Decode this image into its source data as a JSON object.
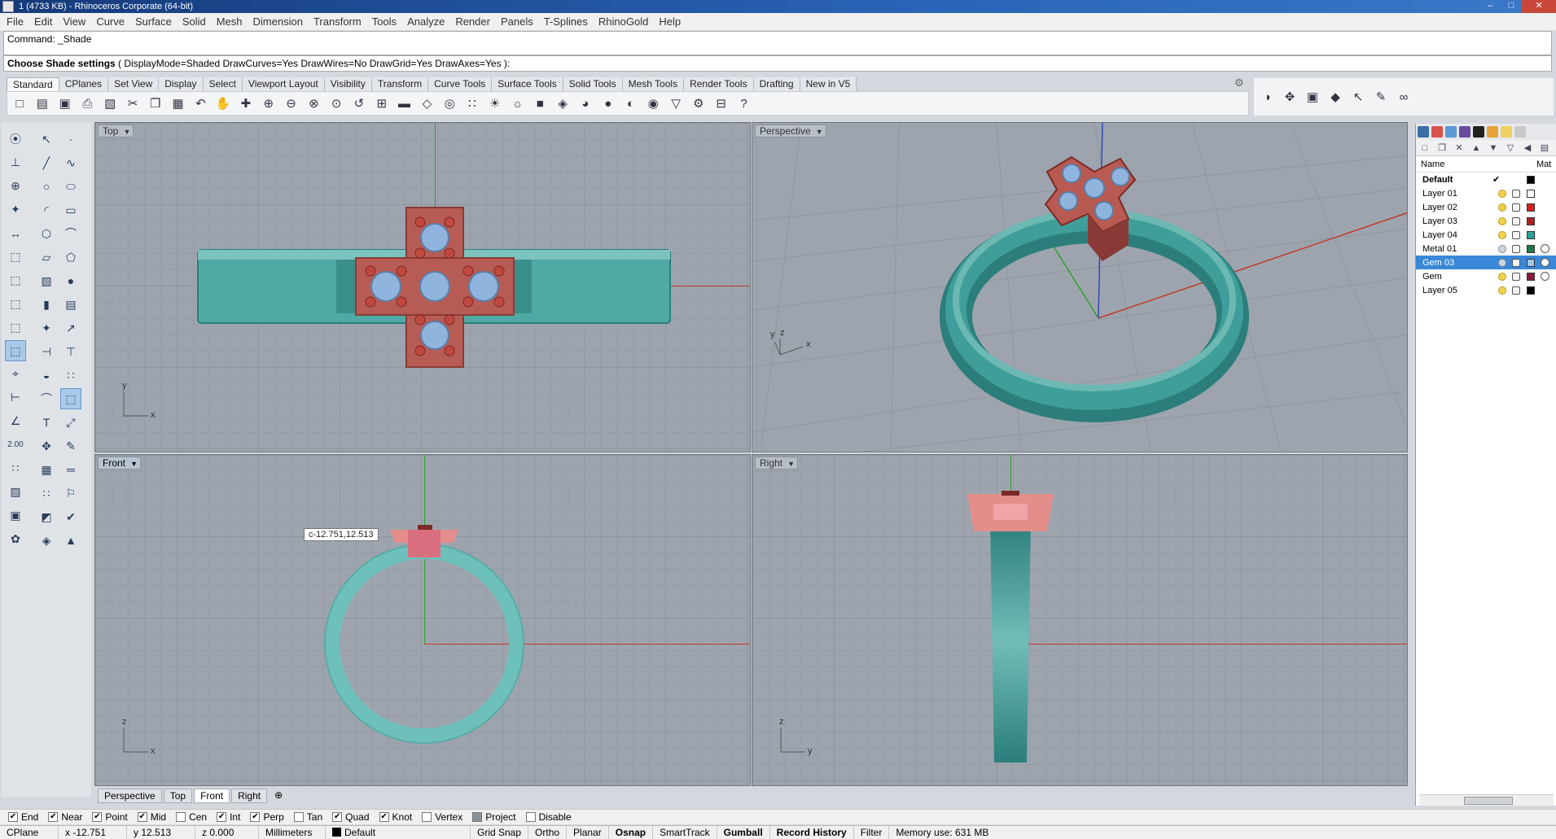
{
  "window": {
    "title": "1 (4733 KB) - Rhinoceros Corporate (64-bit)",
    "controls": [
      "–",
      "□",
      "✕"
    ]
  },
  "menu": [
    "File",
    "Edit",
    "View",
    "Curve",
    "Surface",
    "Solid",
    "Mesh",
    "Dimension",
    "Transform",
    "Tools",
    "Analyze",
    "Render",
    "Panels",
    "T-Splines",
    "RhinoGold",
    "Help"
  ],
  "command": {
    "history": "Command: _Shade",
    "prompt_bold": "Choose Shade settings",
    "prompt_rest": " ( DisplayMode=Shaded  DrawCurves=Yes  DrawWires=No  DrawGrid=Yes  DrawAxes=Yes ):"
  },
  "toolbar_tabs": [
    "Standard",
    "CPlanes",
    "Set View",
    "Display",
    "Select",
    "Viewport Layout",
    "Visibility",
    "Transform",
    "Curve Tools",
    "Surface Tools",
    "Solid Tools",
    "Mesh Tools",
    "Render Tools",
    "Drafting",
    "New in V5"
  ],
  "toolbar_icons": [
    {
      "name": "new-icon",
      "glyph": "□"
    },
    {
      "name": "open-icon",
      "glyph": "▤"
    },
    {
      "name": "save-icon",
      "glyph": "▣"
    },
    {
      "name": "print-icon",
      "glyph": "⎙"
    },
    {
      "name": "import-icon",
      "glyph": "▧"
    },
    {
      "name": "cut-icon",
      "glyph": "✂"
    },
    {
      "name": "copy-icon",
      "glyph": "❐"
    },
    {
      "name": "paste-icon",
      "glyph": "▦"
    },
    {
      "name": "undo-icon",
      "glyph": "↶"
    },
    {
      "name": "pan-icon",
      "glyph": "✋"
    },
    {
      "name": "rotate-view-icon",
      "glyph": "✚"
    },
    {
      "name": "zoom-dynamic-icon",
      "glyph": "⊕"
    },
    {
      "name": "zoom-window-icon",
      "glyph": "⊖"
    },
    {
      "name": "zoom-extents-icon",
      "glyph": "⊗"
    },
    {
      "name": "zoom-selected-icon",
      "glyph": "⊙"
    },
    {
      "name": "undo-view-icon",
      "glyph": "↺"
    },
    {
      "name": "four-viewports-icon",
      "glyph": "⊞"
    },
    {
      "name": "car-icon",
      "glyph": "▬"
    },
    {
      "name": "box-edit-icon",
      "glyph": "◇"
    },
    {
      "name": "osnap-icon",
      "glyph": "◎"
    },
    {
      "name": "select-points-icon",
      "glyph": "∷"
    },
    {
      "name": "light-icon",
      "glyph": "☀"
    },
    {
      "name": "light-off-icon",
      "glyph": "☼"
    },
    {
      "name": "lock-icon",
      "glyph": "■"
    },
    {
      "name": "layer-icon",
      "glyph": "◈"
    },
    {
      "name": "color-wheel-icon",
      "glyph": "◕"
    },
    {
      "name": "sphere-shaded-icon",
      "glyph": "●"
    },
    {
      "name": "sphere-rendered-icon",
      "glyph": "◐"
    },
    {
      "name": "sphere-blue-icon",
      "glyph": "◉"
    },
    {
      "name": "filter-icon",
      "glyph": "▽"
    },
    {
      "name": "options-gear-icon",
      "glyph": "⚙"
    },
    {
      "name": "grid-tool-icon",
      "glyph": "⊟"
    },
    {
      "name": "help-icon",
      "glyph": "?"
    }
  ],
  "toolbar_right_icons": [
    {
      "name": "shaded-ball-icon",
      "glyph": "◑"
    },
    {
      "name": "move-icon",
      "glyph": "✥"
    },
    {
      "name": "save-small-icon",
      "glyph": "▣"
    },
    {
      "name": "cube-blue-icon",
      "glyph": "◆"
    },
    {
      "name": "pointer-icon",
      "glyph": "↖"
    },
    {
      "name": "edit-tool-icon",
      "glyph": "✎"
    },
    {
      "name": "link-icon",
      "glyph": "∞"
    }
  ],
  "toolbox": {
    "col1": [
      {
        "name": "cancel-icon",
        "glyph": "⦿"
      },
      {
        "name": "cplane-icon",
        "glyph": "⊥"
      },
      {
        "name": "globe-icon",
        "glyph": "⊕"
      },
      {
        "name": "gumball-icon",
        "glyph": "✦"
      },
      {
        "name": "dimension-icon",
        "glyph": "↔"
      },
      {
        "name": "box-tool-icon",
        "glyph": "⬚"
      },
      {
        "name": "box-tool-2-icon",
        "glyph": "⬚"
      },
      {
        "name": "box-tool-3-icon",
        "glyph": "⬚"
      },
      {
        "name": "box-tool-4-icon",
        "glyph": "⬚"
      },
      {
        "name": "box-tool-selected-icon",
        "glyph": "⬚"
      },
      {
        "name": "snap-tool-icon",
        "glyph": "⌖"
      },
      {
        "name": "ortho-tool-icon",
        "glyph": "⊢"
      },
      {
        "name": "radius-tool-icon",
        "glyph": "∠"
      },
      {
        "name": "value-box-icon",
        "glyph": "∷"
      },
      {
        "name": "hatch-icon",
        "glyph": "▨"
      },
      {
        "name": "frame-icon",
        "glyph": "▣"
      },
      {
        "name": "color-flower-icon",
        "glyph": "✿"
      }
    ],
    "value_label": "2.00",
    "col2": [
      {
        "name": "select-icon",
        "glyph": "↖"
      },
      {
        "name": "point-icon",
        "glyph": "·"
      },
      {
        "name": "polyline-icon",
        "glyph": "╱"
      },
      {
        "name": "curve-icon",
        "glyph": "∿"
      },
      {
        "name": "circle-icon",
        "glyph": "○"
      },
      {
        "name": "ellipse-icon",
        "glyph": "⬭"
      },
      {
        "name": "arc-icon",
        "glyph": "◜"
      },
      {
        "name": "rectangle-icon",
        "glyph": "▭"
      },
      {
        "name": "polygon-icon",
        "glyph": "⬡"
      },
      {
        "name": "fillet-icon",
        "glyph": "⌒"
      },
      {
        "name": "surface-icon",
        "glyph": "▱"
      },
      {
        "name": "loft-icon",
        "glyph": "⬠"
      },
      {
        "name": "solid-box-icon",
        "glyph": "▧"
      },
      {
        "name": "sphere-tool-icon",
        "glyph": "●"
      },
      {
        "name": "cylinder-icon",
        "glyph": "▮"
      },
      {
        "name": "extrude-icon",
        "glyph": "▤"
      },
      {
        "name": "mesh-icon",
        "glyph": "✦"
      },
      {
        "name": "arrow-icon",
        "glyph": "↗"
      },
      {
        "name": "dim-tool-icon",
        "glyph": "⊣"
      },
      {
        "name": "dim-tool-2-icon",
        "glyph": "⊤"
      },
      {
        "name": "boolean-icon",
        "glyph": "◒"
      },
      {
        "name": "split-icon",
        "glyph": "∷"
      },
      {
        "name": "trim-icon",
        "glyph": "⌒"
      },
      {
        "name": "offset-icon",
        "glyph": "⬚"
      },
      {
        "name": "text-icon",
        "glyph": "T"
      },
      {
        "name": "scale-icon",
        "glyph": "⤢"
      },
      {
        "name": "transform-icon",
        "glyph": "✥"
      },
      {
        "name": "edit-pts-icon",
        "glyph": "✎"
      },
      {
        "name": "solid-edit-icon",
        "glyph": "▦"
      },
      {
        "name": "ruler-icon",
        "glyph": "═"
      },
      {
        "name": "array-icon",
        "glyph": "∷"
      },
      {
        "name": "render-tool-icon",
        "glyph": "⚐"
      },
      {
        "name": "drafting-icon",
        "glyph": "◩"
      },
      {
        "name": "check-icon",
        "glyph": "✔"
      },
      {
        "name": "mesh-tool-icon",
        "glyph": "◈"
      },
      {
        "name": "cone-icon",
        "glyph": "▲"
      }
    ]
  },
  "viewports": {
    "top": {
      "label": "Top",
      "axis_x": "x",
      "axis_y": "y"
    },
    "perspective": {
      "label": "Perspective",
      "axis_x": "x",
      "axis_y": "y",
      "axis_z": "z"
    },
    "front": {
      "label": "Front",
      "axis_x": "x",
      "axis_z": "z"
    },
    "right": {
      "label": "Right",
      "axis_y": "y",
      "axis_z": "z"
    }
  },
  "coord_tooltip": "c-12.751,12.513",
  "viewport_tabs": [
    "Perspective",
    "Top",
    "Front",
    "Right"
  ],
  "viewport_tab_add": "⊕",
  "colors": {
    "ring": "#3f9e9a",
    "ring_dark": "#2b7e7b",
    "ring_light": "#78c2be",
    "cross": "#b85a52",
    "cross_dark": "#8a3a36",
    "gem": "#8fb4de",
    "grid_bg": "#9da4ad"
  },
  "layers": {
    "header_name": "Name",
    "header_mat": "Mat",
    "rows": [
      {
        "name": "Default",
        "current": "✔",
        "color": "#000000",
        "bold": true
      },
      {
        "name": "Layer 01",
        "color": "#ffffff"
      },
      {
        "name": "Layer 02",
        "color": "#d81e1e"
      },
      {
        "name": "Layer 03",
        "color": "#b22222"
      },
      {
        "name": "Layer 04",
        "color": "#2aa39a"
      },
      {
        "name": "Metal 01",
        "color": "#1f7a4a",
        "mat": true
      },
      {
        "name": "Gem 03",
        "color": "#9fc7e8",
        "mat": true,
        "selected": true
      },
      {
        "name": "Gem",
        "color": "#8a1a3a",
        "mat": true
      },
      {
        "name": "Layer 05",
        "color": "#000000"
      }
    ]
  },
  "osnaps": [
    {
      "label": "End",
      "checked": true
    },
    {
      "label": "Near",
      "checked": true
    },
    {
      "label": "Point",
      "checked": true
    },
    {
      "label": "Mid",
      "checked": true
    },
    {
      "label": "Cen",
      "checked": false
    },
    {
      "label": "Int",
      "checked": true
    },
    {
      "label": "Perp",
      "checked": true
    },
    {
      "label": "Tan",
      "checked": false
    },
    {
      "label": "Quad",
      "checked": true
    },
    {
      "label": "Knot",
      "checked": true
    },
    {
      "label": "Vertex",
      "checked": false
    },
    {
      "label": "Project",
      "checked": false
    },
    {
      "label": "Disable",
      "checked": false
    }
  ],
  "status": {
    "cplane": "CPlane",
    "x": "x -12.751",
    "y": "y 12.513",
    "z": "z 0.000",
    "units": "Millimeters",
    "layer": "Default",
    "grid_snap": "Grid Snap",
    "ortho": "Ortho",
    "planar": "Planar",
    "osnap": "Osnap",
    "smarttrack": "SmartTrack",
    "gumball": "Gumball",
    "record_history": "Record History",
    "filter": "Filter",
    "memory": "Memory use: 631 MB"
  }
}
